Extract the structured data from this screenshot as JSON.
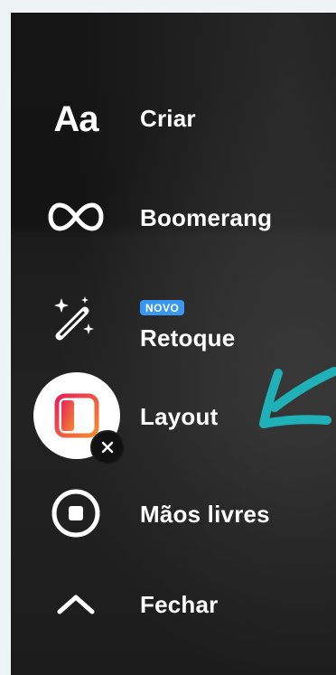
{
  "menu": {
    "items": [
      {
        "label": "Criar",
        "icon": "aa-text-icon",
        "icon_text": "Aa"
      },
      {
        "label": "Boomerang",
        "icon": "infinity-icon"
      },
      {
        "label": "Retoque",
        "icon": "magic-wand-icon",
        "badge": "NOVO"
      },
      {
        "label": "Layout",
        "icon": "layout-grid-icon"
      },
      {
        "label": "Mãos livres",
        "icon": "hands-free-record-icon"
      },
      {
        "label": "Fechar",
        "icon": "chevron-up-icon"
      }
    ]
  },
  "colors": {
    "badge_blue": "#3897f0",
    "arrow_teal": "#1fb0b8",
    "layout_gradient_start": "#e6225d",
    "layout_gradient_end": "#f48a2a"
  }
}
